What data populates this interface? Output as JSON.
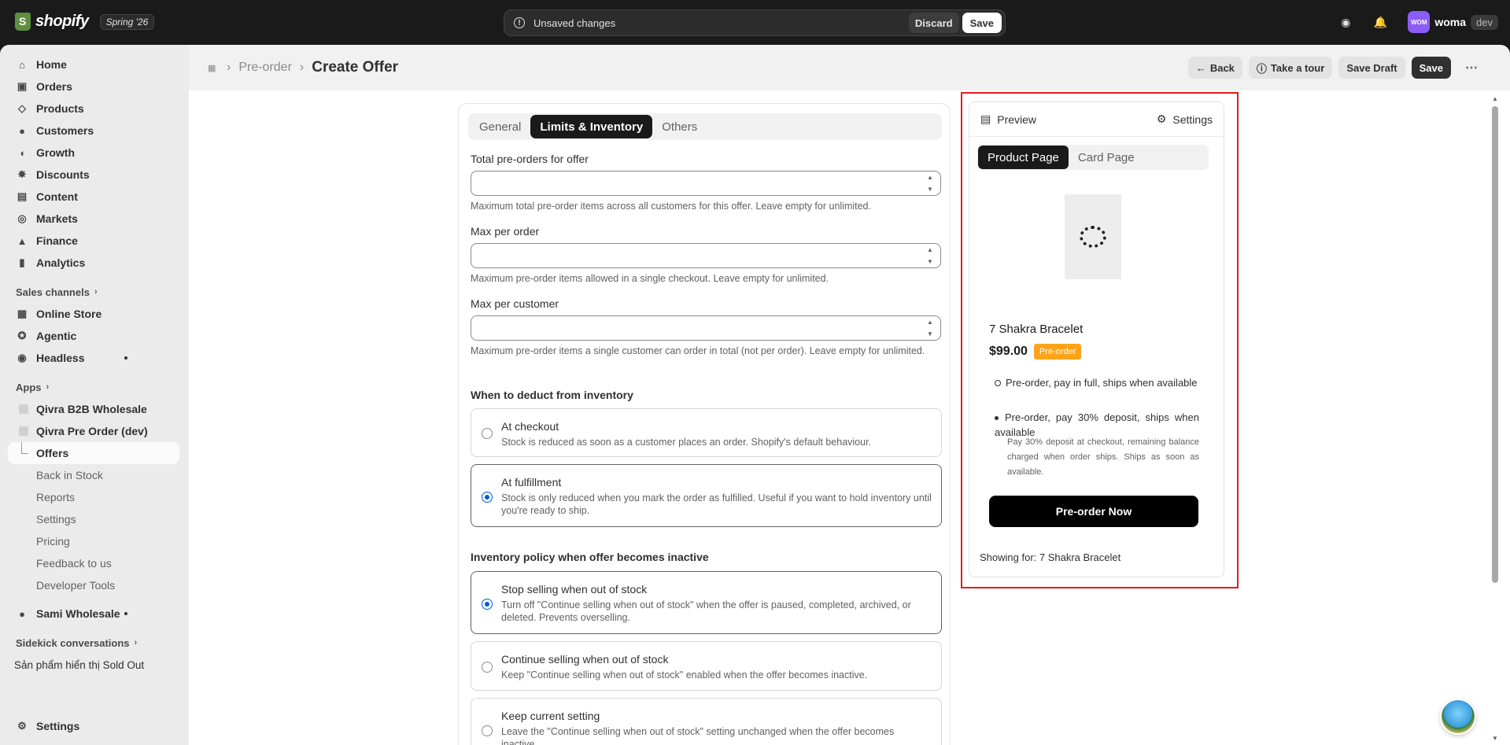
{
  "topbar": {
    "brand": "shopify",
    "season": "Spring '26",
    "unsaved_message": "Unsaved changes",
    "discard_label": "Discard",
    "save_label": "Save",
    "avatar_initials": "WOM",
    "account_name": "woma",
    "env_badge": "dev"
  },
  "sidebar": {
    "main_items": [
      {
        "label": "Home",
        "icon": "home-icon"
      },
      {
        "label": "Orders",
        "icon": "orders-icon"
      },
      {
        "label": "Products",
        "icon": "tag-icon"
      },
      {
        "label": "Customers",
        "icon": "person-icon"
      },
      {
        "label": "Growth",
        "icon": "growth-icon"
      },
      {
        "label": "Discounts",
        "icon": "discount-icon"
      },
      {
        "label": "Content",
        "icon": "content-icon"
      },
      {
        "label": "Markets",
        "icon": "globe-icon"
      },
      {
        "label": "Finance",
        "icon": "bank-icon"
      },
      {
        "label": "Analytics",
        "icon": "bar-chart-icon"
      }
    ],
    "sales_channels_label": "Sales channels",
    "channels": [
      {
        "label": "Online Store"
      },
      {
        "label": "Agentic"
      },
      {
        "label": "Headless"
      }
    ],
    "apps_label": "Apps",
    "apps": [
      {
        "label": "Qivra B2B Wholesale"
      },
      {
        "label": "Qivra Pre Order (dev)"
      }
    ],
    "app_sub_items": [
      "Offers",
      "Back in Stock",
      "Reports",
      "Settings",
      "Pricing",
      "Feedback to us",
      "Developer Tools"
    ],
    "other_app": "Sami Wholesale",
    "sidekick_label": "Sidekick conversations",
    "sidekick_item": "Sản phẩm hiển thị Sold Out",
    "settings_label": "Settings"
  },
  "header": {
    "breadcrumb": "Pre-order",
    "title": "Create Offer",
    "back_label": "Back",
    "tour_label": "Take a tour",
    "save_draft_label": "Save Draft",
    "save_label": "Save"
  },
  "form": {
    "tabs": [
      "General",
      "Limits & Inventory",
      "Others"
    ],
    "active_tab": "Limits & Inventory",
    "fields": [
      {
        "label": "Total pre-orders for offer",
        "value": "",
        "help": "Maximum total pre-order items across all customers for this offer. Leave empty for unlimited."
      },
      {
        "label": "Max per order",
        "value": "",
        "help": "Maximum pre-order items allowed in a single checkout. Leave empty for unlimited."
      },
      {
        "label": "Max per customer",
        "value": "",
        "help": "Maximum pre-order items a single customer can order in total (not per order). Leave empty for unlimited."
      }
    ],
    "deduct_title": "When to deduct from inventory",
    "deduct_options": [
      {
        "title": "At checkout",
        "desc": "Stock is reduced as soon as a customer places an order. Shopify's default behaviour.",
        "selected": false
      },
      {
        "title": "At fulfillment",
        "desc": "Stock is only reduced when you mark the order as fulfilled. Useful if you want to hold inventory until you're ready to ship.",
        "selected": true
      }
    ],
    "policy_title": "Inventory policy when offer becomes inactive",
    "policy_options": [
      {
        "title": "Stop selling when out of stock",
        "desc": "Turn off \"Continue selling when out of stock\" when the offer is paused, completed, archived, or deleted. Prevents overselling.",
        "selected": true
      },
      {
        "title": "Continue selling when out of stock",
        "desc": "Keep \"Continue selling when out of stock\" enabled when the offer becomes inactive.",
        "selected": false
      },
      {
        "title": "Keep current setting",
        "desc": "Leave the \"Continue selling when out of stock\" setting unchanged when the offer becomes inactive.",
        "selected": false
      }
    ]
  },
  "preview": {
    "preview_label": "Preview",
    "settings_label": "Settings",
    "tabs": [
      "Product Page",
      "Card Page"
    ],
    "active_tab": "Product Page",
    "product_name": "7 Shakra Bracelet",
    "price": "$99.00",
    "badge": "Pre-order",
    "option_1": "Pre-order, pay in full, ships when available",
    "option_2": "Pre-order, pay 30% deposit, ships when available",
    "option_2_note": "Pay 30% deposit at checkout, remaining balance charged when order ships. Ships as soon as available.",
    "button_label": "Pre-order Now",
    "showing_for": "Showing for: 7 Shakra Bracelet"
  },
  "colors": {
    "accent": "#005bd3",
    "badge": "#ffa31a",
    "highlight": "#e11d1d",
    "avatar": "#8b5cf6"
  }
}
